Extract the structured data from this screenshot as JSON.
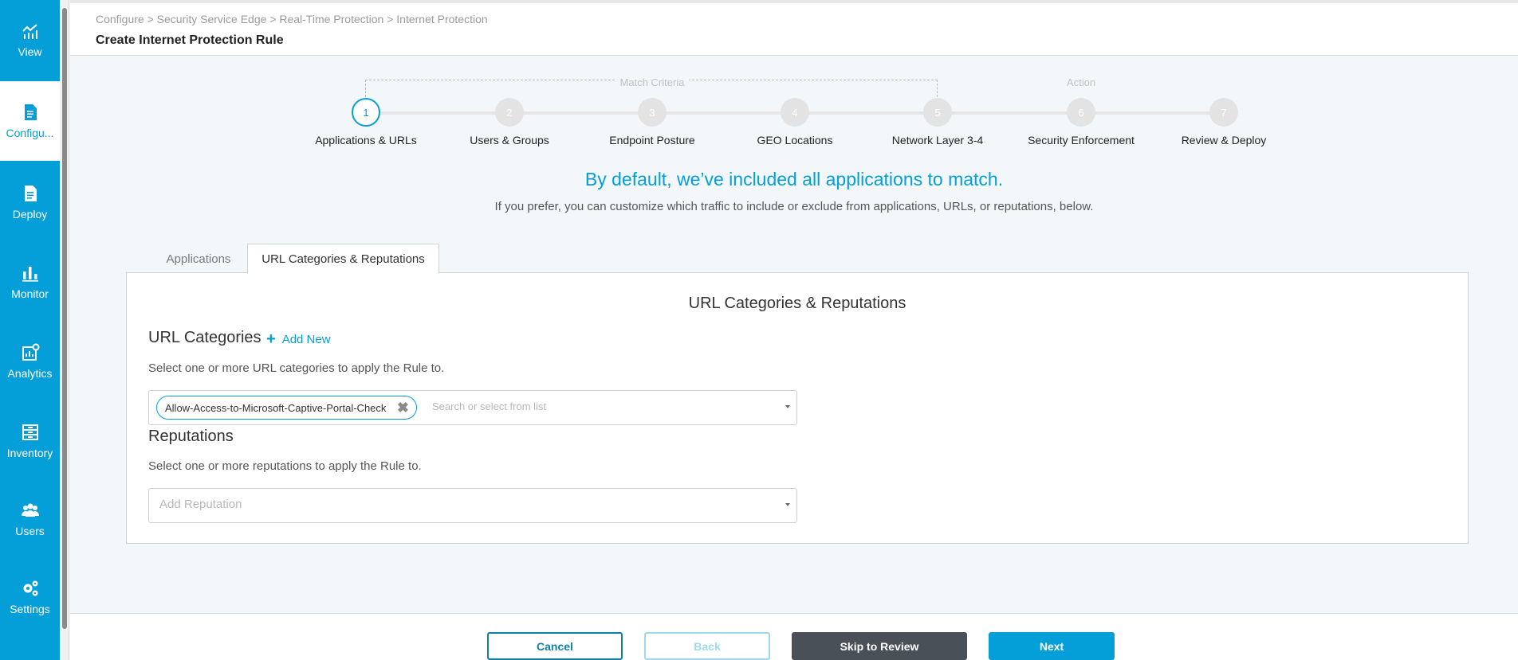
{
  "sidebar": {
    "items": [
      {
        "label": "View",
        "icon": "chart-line-icon",
        "active": false
      },
      {
        "label": "Configu...",
        "icon": "document-icon",
        "active": true
      },
      {
        "label": "Deploy",
        "icon": "document-icon",
        "active": false
      },
      {
        "label": "Monitor",
        "icon": "bar-chart-icon",
        "active": false
      },
      {
        "label": "Analytics",
        "icon": "analytics-icon",
        "active": false
      },
      {
        "label": "Inventory",
        "icon": "inventory-icon",
        "active": false
      },
      {
        "label": "Users",
        "icon": "users-icon",
        "active": false
      },
      {
        "label": "Settings",
        "icon": "gear-icon",
        "active": false
      }
    ]
  },
  "header": {
    "breadcrumb": "Configure > Security Service Edge > Real-Time Protection > Internet Protection",
    "title": "Create Internet Protection Rule"
  },
  "stepper": {
    "match_criteria_label": "Match Criteria",
    "action_label": "Action",
    "steps": [
      {
        "number": "1",
        "label": "Applications & URLs",
        "active": true
      },
      {
        "number": "2",
        "label": "Users & Groups",
        "active": false
      },
      {
        "number": "3",
        "label": "Endpoint Posture",
        "active": false
      },
      {
        "number": "4",
        "label": "GEO Locations",
        "active": false
      },
      {
        "number": "5",
        "label": "Network Layer 3-4",
        "active": false
      },
      {
        "number": "6",
        "label": "Security Enforcement",
        "active": false
      },
      {
        "number": "7",
        "label": "Review & Deploy",
        "active": false
      }
    ]
  },
  "intro": {
    "title": "By default, we’ve included all applications to match.",
    "subtitle": "If you prefer, you can customize which traffic to include or exclude from applications, URLs, or reputations, below."
  },
  "tabs": [
    {
      "label": "Applications",
      "active": false
    },
    {
      "label": "URL Categories & Reputations",
      "active": true
    }
  ],
  "panel": {
    "title": "URL Categories & Reputations",
    "url_categories": {
      "heading": "URL Categories",
      "add_new_label": "Add New",
      "help": "Select one or more URL categories to apply the Rule to.",
      "selected": [
        "Allow-Access-to-Microsoft-Captive-Portal-Check"
      ],
      "placeholder": "Search or select from list"
    },
    "reputations": {
      "heading": "Reputations",
      "help": "Select one or more reputations to apply the Rule to.",
      "placeholder": "Add Reputation"
    }
  },
  "footer": {
    "cancel_label": "Cancel",
    "back_label": "Back",
    "skip_label": "Skip to Review",
    "next_label": "Next"
  },
  "colors": {
    "accent": "#049fd9",
    "sidebar_bg": "#049fd9",
    "dark_button": "#495057"
  }
}
